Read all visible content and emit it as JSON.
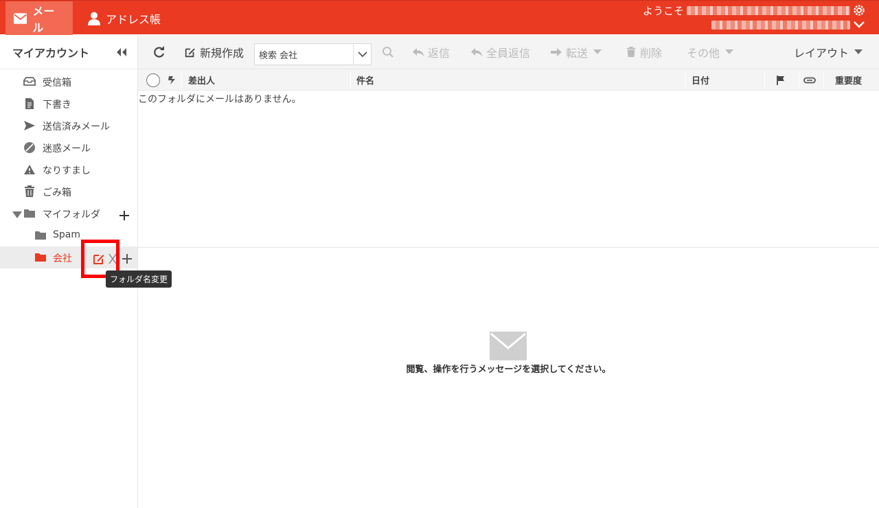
{
  "topbar": {
    "mail_tab": "メール",
    "address_tab": "アドレス帳",
    "welcome": "ようこそ",
    "accent_color": "#ea3a22"
  },
  "sidebar": {
    "title": "マイアカウント",
    "folders": [
      {
        "label": "受信箱",
        "icon": "inbox-icon"
      },
      {
        "label": "下書き",
        "icon": "draft-icon"
      },
      {
        "label": "送信済みメール",
        "icon": "send-icon"
      },
      {
        "label": "迷惑メール",
        "icon": "block-icon"
      },
      {
        "label": "なりすまし",
        "icon": "warning-icon"
      },
      {
        "label": "ごみ箱",
        "icon": "trash-icon"
      },
      {
        "label": "マイフォルダ",
        "icon": "folder-open-icon"
      }
    ],
    "subfolders": [
      {
        "label": "Spam",
        "icon": "folder-icon"
      },
      {
        "label": "会社",
        "icon": "folder-icon",
        "active": true
      }
    ],
    "tooltip": "フォルダ名変更"
  },
  "toolbar": {
    "new_label": "新規作成",
    "search_value": "検索 会社",
    "reply_label": "返信",
    "reply_all_label": "全員返信",
    "forward_label": "転送",
    "delete_label": "削除",
    "more_label": "その他",
    "layout_label": "レイアウト"
  },
  "list": {
    "columns": {
      "from": "差出人",
      "subject": "件名",
      "date": "日付",
      "priority": "重要度"
    },
    "empty_message": "このフォルダにメールはありません。"
  },
  "preview": {
    "message": "閲覧、操作を行うメッセージを選択してください。"
  }
}
